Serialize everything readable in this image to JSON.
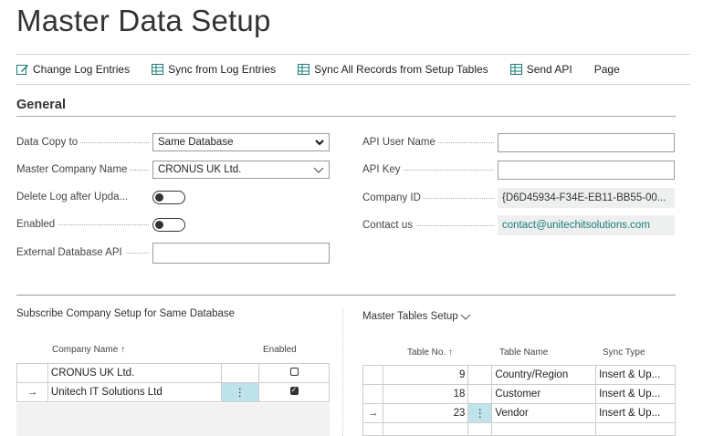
{
  "page": {
    "title": "Master Data Setup"
  },
  "toolbar": {
    "items": [
      {
        "label": "Change Log Entries",
        "icon": "edit-log-icon"
      },
      {
        "label": "Sync from Log Entries",
        "icon": "sync-table-icon"
      },
      {
        "label": "Sync All Records from Setup Tables",
        "icon": "sync-all-icon"
      },
      {
        "label": "Send API",
        "icon": "send-api-icon"
      },
      {
        "label": "Page",
        "icon": ""
      }
    ]
  },
  "general": {
    "title": "General",
    "left": {
      "data_copy_to": {
        "label": "Data Copy to",
        "value": "Same Database"
      },
      "master_company": {
        "label": "Master Company Name",
        "value": "CRONUS UK Ltd."
      },
      "delete_log": {
        "label": "Delete Log after Upda...",
        "value": "off"
      },
      "enabled": {
        "label": "Enabled",
        "value": "off"
      },
      "external_api": {
        "label": "External Database API",
        "value": ""
      }
    },
    "right": {
      "api_user": {
        "label": "API User Name",
        "value": ""
      },
      "api_key": {
        "label": "API Key",
        "value": ""
      },
      "company_id": {
        "label": "Company ID",
        "value": "{D6D45934-F34E-EB11-BB55-00..."
      },
      "contact": {
        "label": "Contact us",
        "value": "contact@unitechitsolutions.com"
      }
    }
  },
  "subscribe": {
    "title": "Subscribe Company Setup for Same Database",
    "col_company": "Company Name ↑",
    "col_enabled": "Enabled",
    "rows": [
      {
        "marker": "",
        "name": "CRONUS UK Ltd.",
        "enabled": false,
        "selected": false
      },
      {
        "marker": "→",
        "name": "Unitech IT Solutions Ltd",
        "enabled": true,
        "selected": true
      }
    ]
  },
  "master_tables": {
    "title": "Master Tables Setup",
    "col_no": "Table No. ↑",
    "col_name": "Table Name",
    "col_sync": "Sync Type",
    "rows": [
      {
        "marker": "",
        "no": "9",
        "name": "Country/Region",
        "sync": "Insert & Up..."
      },
      {
        "marker": "",
        "no": "18",
        "name": "Customer",
        "sync": "Insert & Up..."
      },
      {
        "marker": "→",
        "no": "23",
        "name": "Vendor",
        "sync": "Insert & Up..."
      }
    ]
  }
}
